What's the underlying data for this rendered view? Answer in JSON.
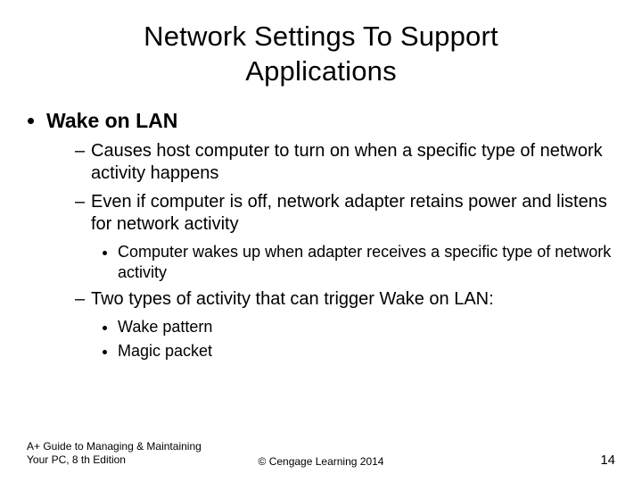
{
  "title_line1": "Network Settings To Support",
  "title_line2": "Applications",
  "bullet1": "Wake on LAN",
  "sub1": "Causes host computer to turn on when a specific type of network activity happens",
  "sub2": "Even if computer is off, network adapter retains power and listens for network activity",
  "sub2_inner1": "Computer wakes up when adapter receives a specific type of network activity",
  "sub3": "Two types of activity that can trigger Wake on LAN:",
  "sub3_inner1": "Wake pattern",
  "sub3_inner2": "Magic packet",
  "footer_left": "A+ Guide to Managing & Maintaining Your PC, 8 th Edition",
  "footer_center": "© Cengage Learning 2014",
  "page_number": "14"
}
